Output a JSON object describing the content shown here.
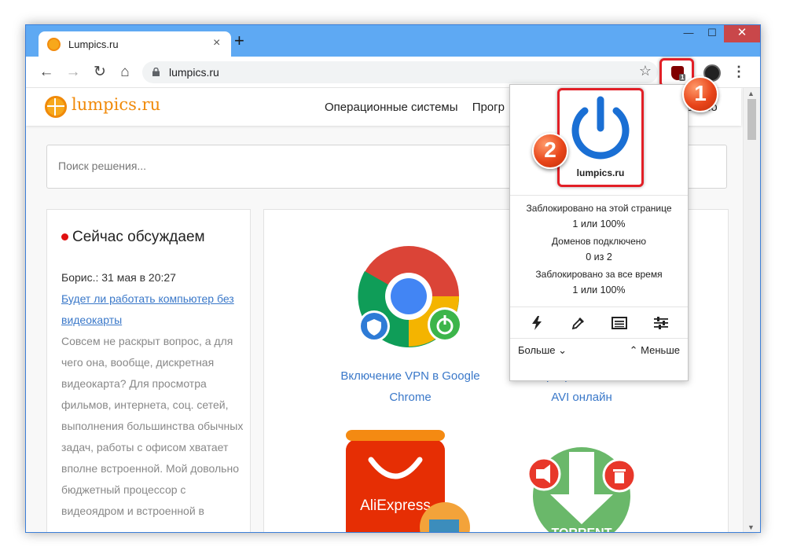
{
  "browser": {
    "tab_title": "Lumpics.ru",
    "tab_close": "×",
    "new_tab": "+",
    "window_minimize": "—",
    "window_maximize": "☐",
    "window_close": "✕",
    "back": "←",
    "forward": "→",
    "reload": "↻",
    "home": "⌂",
    "url": "lumpics.ru",
    "bookmark_star": "☆",
    "extension_badge": "1",
    "menu": "⋮"
  },
  "site": {
    "name": "lumpics.ru",
    "nav": [
      "Операционные системы",
      "Прогр"
    ],
    "nav_right": "елезо",
    "search_placeholder": "Поиск решения..."
  },
  "sidebar": {
    "title": "Сейчас обсуждаем",
    "comment_meta": "Борис.: 31 мая в 20:27",
    "comment_link": "Будет ли работать компьютер без видеокарты",
    "comment_text": "Совсем не раскрыт вопрос, а для чего она, вообще, дискретная видеокарта? Для просмотра фильмов, интернета, соц. сетей, выполнения большинства обычных задач, работы с офисом хватает вполне встроенной. Мой довольно бюджетный процессор с видеоядром и встроенной в"
  },
  "articles": [
    {
      "title": "Включение VPN в Google Chrome",
      "image": "chrome-vpn-icon"
    },
    {
      "title": "Конвертирование MOV в AVI онлайн",
      "image": "converter-icon"
    },
    {
      "title": "",
      "image": "aliexpress-icon",
      "image_text": "AliExpress"
    },
    {
      "title": "",
      "image": "torrent-icon",
      "image_text": "TORRENT"
    }
  ],
  "popup": {
    "domain": "lumpics.ru",
    "stats": [
      {
        "label": "Заблокировано на этой странице",
        "value": "1 или 100%"
      },
      {
        "label": "Доменов подключено",
        "value": "0 из 2"
      },
      {
        "label": "Заблокировано за все время",
        "value": "1 или 100%"
      }
    ],
    "tools": [
      "lightning-icon",
      "eyedropper-icon",
      "logger-icon",
      "settings-sliders-icon"
    ],
    "more_label": "Больше",
    "less_label": "Меньше",
    "power_color": "#1a6fd4"
  },
  "callouts": {
    "one": "1",
    "two": "2"
  },
  "colors": {
    "titlebar": "#5ea9f3",
    "accent_red": "#e21f26",
    "site_orange": "#f08a0a",
    "link": "#3a78c9"
  }
}
